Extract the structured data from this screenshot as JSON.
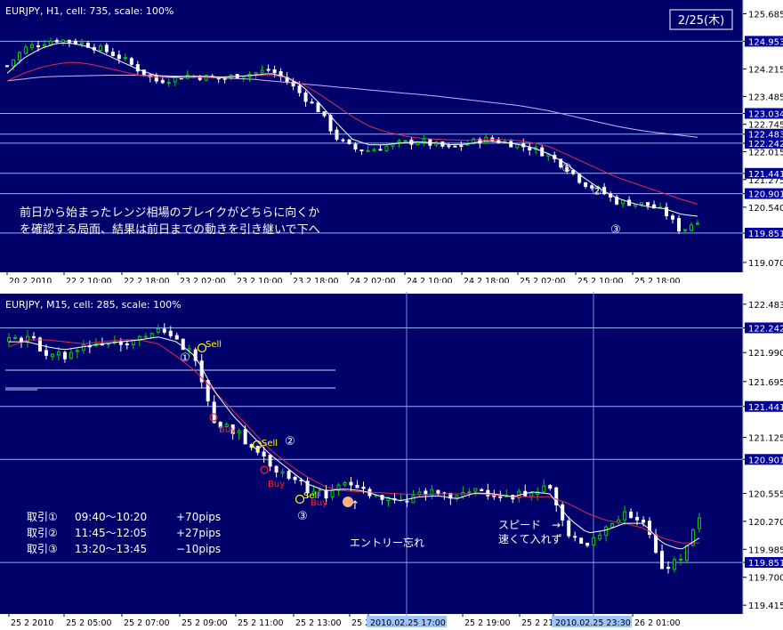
{
  "top_chart": {
    "header": "EURJPY, H1, cell: 735, scale: 100%",
    "date_box": "2/25(木)",
    "annotation_line1": "前日から始まったレンジ相場のブレイクがどちらに向くか",
    "annotation_line2": "を確認する局面、結果は前日までの動きを引き継いで下へ",
    "markers": [
      "①",
      "②",
      "③"
    ]
  },
  "bottom_chart": {
    "header": "EURJPY, M15, cell: 285, scale: 100%",
    "markers": [
      "①",
      "②",
      "③"
    ],
    "signal_sell": "Sell",
    "signal_buy": "Buy",
    "entry_arrow": "↑",
    "entry_note": "エントリー忘れ",
    "speed_note_line1": "スピード　→",
    "speed_note_line2": "速くて入れず",
    "trades": [
      {
        "label": "取引①",
        "time": "09:40～10:20",
        "result": "+70pips"
      },
      {
        "label": "取引②",
        "time": "11:45～12:05",
        "result": "+27pips"
      },
      {
        "label": "取引③",
        "time": "13:20～13:45",
        "result": "−10pips"
      }
    ],
    "time_highlights": [
      "2010.02.25 17:00",
      "2010.02.25 23:30"
    ]
  },
  "colors": {
    "background": "#00006b",
    "axis_text": "#000000",
    "hline": "#8fb0ff",
    "bull": "#00d000",
    "bear": "#ffffff",
    "ma_fast": "#ffffff",
    "ma_mid": "#e02a4a",
    "ma_slow": "#d0b0ff",
    "price_tag_bg": "#0000a0",
    "time_highlight_bg": "#9cc4ff",
    "sell_color": "#ffff00",
    "buy_color": "#ff2020",
    "entry_dot": "#ffb080"
  },
  "chart_data": [
    {
      "type": "candlestick",
      "title": "EURJPY, H1, cell: 735, scale: 100%",
      "y_ticks": [
        125.685,
        124.953,
        124.215,
        123.485,
        123.034,
        122.745,
        122.483,
        122.242,
        122.015,
        121.441,
        121.275,
        120.901,
        120.54,
        119.851,
        119.07
      ],
      "highlighted_levels": [
        124.953,
        123.034,
        122.483,
        122.242,
        121.441,
        120.901,
        119.851
      ],
      "x_tick_labels": [
        "20 2 2010",
        "22 2 10:00",
        "22 2 18:00",
        "23 2 02:00",
        "23 2 10:00",
        "23 2 18:00",
        "24 2 02:00",
        "24 2 10:00",
        "24 2 18:00",
        "25 2 02:00",
        "25 2 10:00",
        "25 2 18:00"
      ],
      "ylim": [
        118.95,
        125.72
      ],
      "close_path": [
        124.3,
        124.75,
        124.9,
        125.0,
        124.95,
        124.85,
        124.7,
        124.5,
        124.2,
        123.9,
        123.95,
        124.05,
        124.0,
        123.95,
        124.05,
        124.1,
        124.2,
        123.9,
        123.5,
        123.1,
        122.4,
        122.1,
        122.05,
        122.15,
        122.25,
        122.3,
        122.2,
        122.1,
        122.25,
        122.35,
        122.3,
        122.2,
        122.1,
        121.9,
        121.6,
        121.2,
        121.0,
        120.7,
        120.65,
        120.6,
        120.4,
        119.9,
        120.2
      ],
      "moving_averages": {
        "fast": [
          124.1,
          124.5,
          124.75,
          124.9,
          124.9,
          124.8,
          124.6,
          124.4,
          124.2,
          124.05,
          124.0,
          124.02,
          124.02,
          124.0,
          124.02,
          124.05,
          124.1,
          124.0,
          123.75,
          123.3,
          122.8,
          122.35,
          122.2,
          122.2,
          122.25,
          122.28,
          122.25,
          122.2,
          122.22,
          122.3,
          122.28,
          122.22,
          122.12,
          121.95,
          121.7,
          121.35,
          121.05,
          120.8,
          120.65,
          120.55,
          120.5,
          120.35,
          120.3
        ],
        "mid": [
          123.9,
          124.1,
          124.25,
          124.35,
          124.4,
          124.35,
          124.25,
          124.15,
          124.05,
          124.0,
          123.98,
          123.98,
          124.0,
          124.0,
          124.02,
          124.04,
          124.05,
          124.0,
          123.8,
          123.55,
          123.25,
          122.95,
          122.7,
          122.55,
          122.45,
          122.38,
          122.35,
          122.33,
          122.32,
          122.34,
          122.34,
          122.32,
          122.25,
          122.15,
          121.95,
          121.75,
          121.55,
          121.35,
          121.2,
          121.05,
          120.9,
          120.75,
          120.62
        ],
        "slow": [
          123.9,
          123.95,
          124.0,
          124.02,
          124.03,
          124.04,
          124.05,
          124.05,
          124.05,
          124.04,
          124.03,
          124.02,
          124.0,
          123.98,
          123.96,
          123.94,
          123.9,
          123.86,
          123.82,
          123.78,
          123.74,
          123.7,
          123.66,
          123.62,
          123.58,
          123.54,
          123.5,
          123.45,
          123.4,
          123.35,
          123.3,
          123.25,
          123.18,
          123.1,
          123.0,
          122.9,
          122.8,
          122.7,
          122.62,
          122.55,
          122.5,
          122.45,
          122.4
        ]
      }
    },
    {
      "type": "candlestick",
      "title": "EURJPY, M15, cell: 285, scale: 100%",
      "y_ticks": [
        122.483,
        122.242,
        121.99,
        121.695,
        121.441,
        121.125,
        120.901,
        120.555,
        120.27,
        119.985,
        119.851,
        119.7,
        119.415
      ],
      "highlighted_levels": [
        122.242,
        121.441,
        120.901,
        119.851
      ],
      "x_tick_labels": [
        "25 2 2010",
        "25 2 05:00",
        "25 2 07:00",
        "25 2 09:00",
        "25 2 11:00",
        "25 2 13:00",
        "25 2",
        "2010.02.25 17:00",
        "25 2 19:00",
        "25 2 21:0",
        "2010.02.25 23:30",
        "26 2 01:00"
      ],
      "ylim": [
        119.38,
        122.5
      ],
      "close_path": [
        122.1,
        122.15,
        122.0,
        121.95,
        122.05,
        122.1,
        122.1,
        122.15,
        122.2,
        122.1,
        121.95,
        121.3,
        121.2,
        121.05,
        120.85,
        120.75,
        120.6,
        120.55,
        120.65,
        120.6,
        120.5,
        120.45,
        120.55,
        120.55,
        120.5,
        120.6,
        120.55,
        120.5,
        120.6,
        120.6,
        120.1,
        120.05,
        120.2,
        120.35,
        120.3,
        119.8,
        119.9,
        120.3
      ]
    }
  ]
}
